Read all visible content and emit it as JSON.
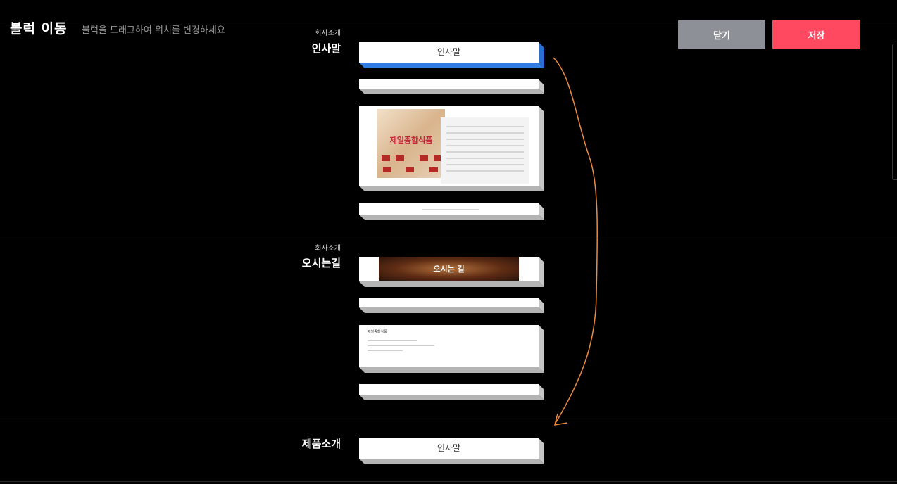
{
  "header": {
    "title": "블럭 이동",
    "subtitle": "블럭을 드래그하여 위치를 변경하세요",
    "close_label": "닫기",
    "save_label": "저장"
  },
  "sections": [
    {
      "category": "회사소개",
      "name": "인사말",
      "blocks": [
        {
          "type": "label",
          "label": "인사말",
          "active": true
        },
        {
          "type": "text-line"
        },
        {
          "type": "image-text",
          "logo_text": "제일종합식품"
        },
        {
          "type": "divider-line"
        }
      ]
    },
    {
      "category": "회사소개",
      "name": "오시는길",
      "blocks": [
        {
          "type": "banner",
          "label": "오시는 길"
        },
        {
          "type": "text-line"
        },
        {
          "type": "address",
          "title": "제일종합식품"
        },
        {
          "type": "divider-line"
        }
      ]
    },
    {
      "category": "",
      "name": "제품소개",
      "blocks": [
        {
          "type": "label",
          "label": "인사말",
          "active": false
        }
      ]
    }
  ],
  "colors": {
    "background": "#000000",
    "close_button": "#8e9097",
    "save_button": "#ff4960",
    "active_block_edge": "#2f7de0",
    "drag_arrow": "#f08a3c"
  }
}
